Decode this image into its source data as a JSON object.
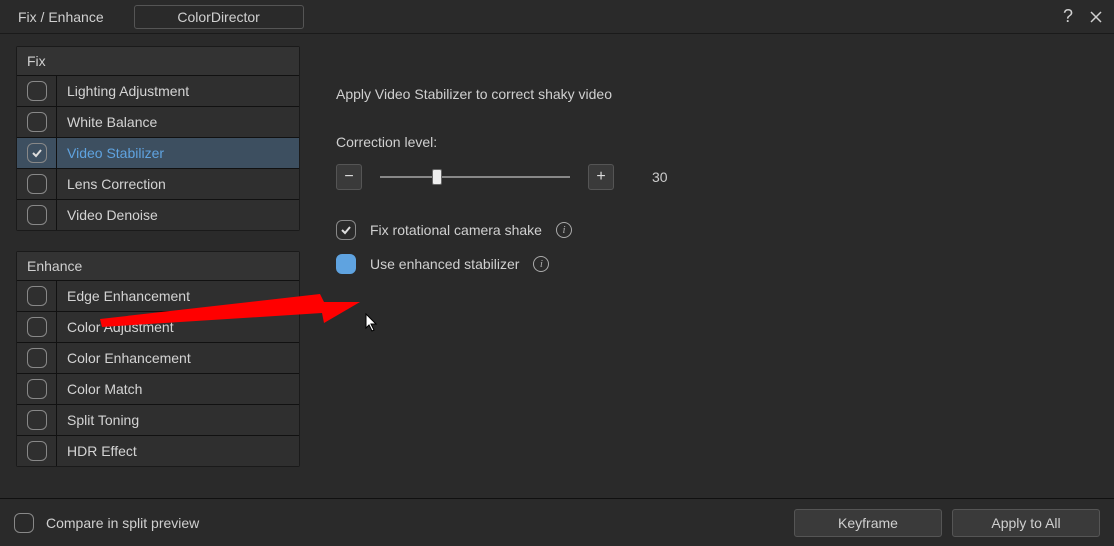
{
  "titlebar": {
    "title": "Fix / Enhance",
    "tab": "ColorDirector"
  },
  "sidebar": {
    "fix": {
      "header": "Fix",
      "items": [
        {
          "label": "Lighting Adjustment",
          "checked": false,
          "active": false
        },
        {
          "label": "White Balance",
          "checked": false,
          "active": false
        },
        {
          "label": "Video Stabilizer",
          "checked": true,
          "active": true
        },
        {
          "label": "Lens Correction",
          "checked": false,
          "active": false
        },
        {
          "label": "Video Denoise",
          "checked": false,
          "active": false
        }
      ]
    },
    "enhance": {
      "header": "Enhance",
      "items": [
        {
          "label": "Edge Enhancement",
          "checked": false,
          "active": false
        },
        {
          "label": "Color Adjustment",
          "checked": false,
          "active": false
        },
        {
          "label": "Color Enhancement",
          "checked": false,
          "active": false
        },
        {
          "label": "Color Match",
          "checked": false,
          "active": false
        },
        {
          "label": "Split Toning",
          "checked": false,
          "active": false
        },
        {
          "label": "HDR Effect",
          "checked": false,
          "active": false
        }
      ]
    }
  },
  "content": {
    "description": "Apply Video Stabilizer to correct shaky video",
    "correction_label": "Correction level:",
    "correction_value": "30",
    "slider_min": 0,
    "slider_max": 100,
    "minus_label": "−",
    "plus_label": "+",
    "fix_rotational": {
      "label": "Fix rotational camera shake",
      "checked": true
    },
    "enhanced_stabilizer": {
      "label": "Use enhanced stabilizer",
      "checked": false,
      "highlighted": true
    }
  },
  "footer": {
    "compare_label": "Compare in split preview",
    "compare_checked": false,
    "keyframe_label": "Keyframe",
    "apply_all_label": "Apply to All"
  }
}
